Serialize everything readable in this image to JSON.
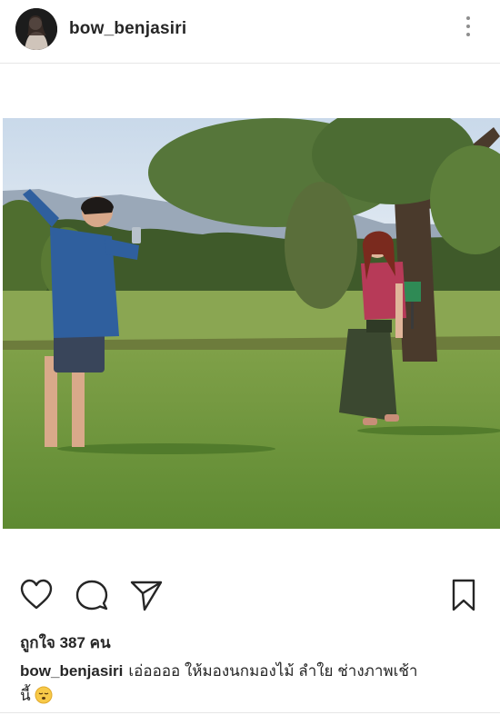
{
  "post": {
    "username": "bow_benjasiri",
    "avatar_icon": "profile-avatar",
    "more_icon": "more-vertical-icon",
    "photo_alt": "",
    "actions": {
      "like_icon": "heart-icon",
      "comment_icon": "comment-icon",
      "share_icon": "send-icon",
      "save_icon": "bookmark-icon"
    },
    "likes_text": "ถูกใจ 387 คน",
    "caption": {
      "username": "bow_benjasiri",
      "text_line1": "เอ่ออออ ให้มองนกมองไม้ ลำใย ช่างภาพเช้า",
      "text_line2": "นี้",
      "emoji_icon": "sleepy-face-emoji"
    }
  },
  "colors": {
    "text": "#262626",
    "icon_gray": "#8e8e8e",
    "divider": "#e6e6e6",
    "background": "#ffffff"
  }
}
